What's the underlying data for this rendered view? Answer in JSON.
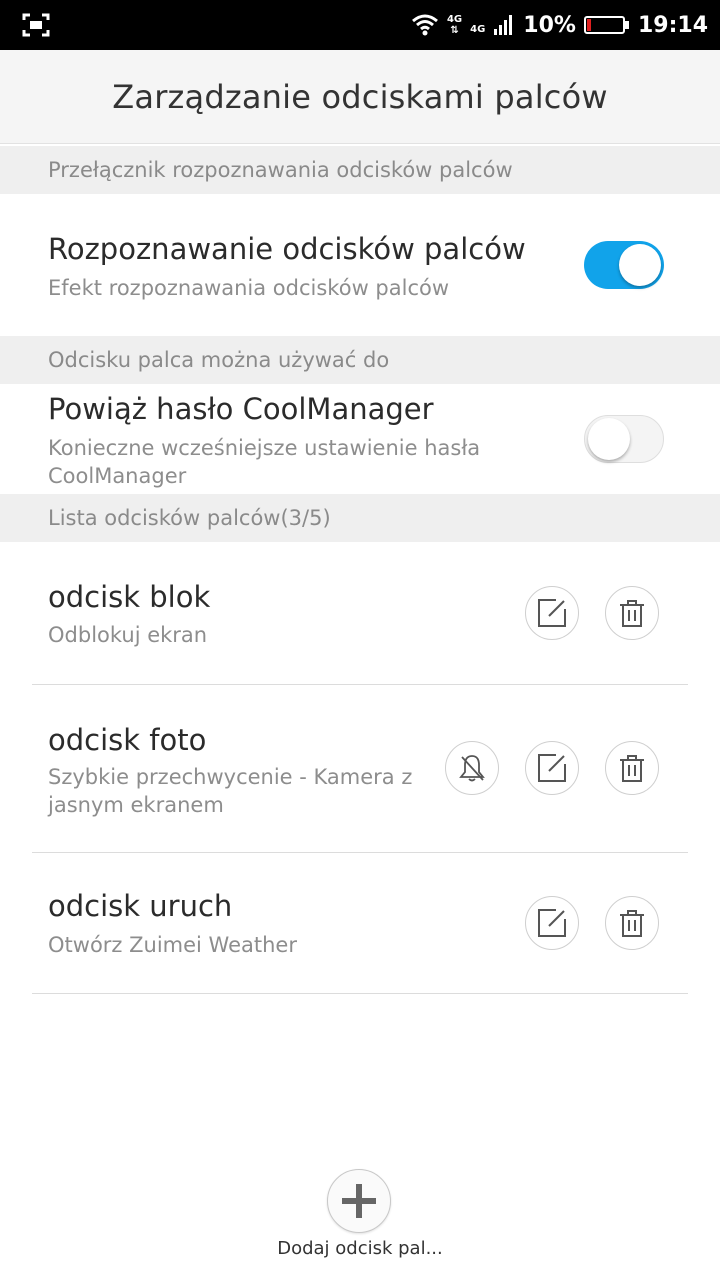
{
  "status_bar": {
    "network_top": "4G",
    "network_bottom": "4G",
    "battery": "10%",
    "time": "19:14",
    "icons": [
      "screenshot-icon",
      "wifi-icon",
      "signal-icon",
      "battery-icon"
    ]
  },
  "title": "Zarządzanie odciskami palców",
  "sections": {
    "switch_header": "Przełącznik rozpoznawania odcisków palców",
    "use_header": "Odcisku palca można używać do",
    "list_header": "Lista odcisków palców(3/5)"
  },
  "recognition": {
    "title": "Rozpoznawanie odcisków palców",
    "subtitle": "Efekt rozpoznawania odcisków palców",
    "enabled": true
  },
  "coolmanager": {
    "title": "Powiąż hasło CoolManager",
    "subtitle_line1": "Konieczne wcześniejsze ustawienie hasła",
    "subtitle_line2": "CoolManager",
    "enabled": false
  },
  "fingerprints": [
    {
      "name": "odcisk blok",
      "action_line1": "Odblokuj ekran",
      "action_line2": "",
      "has_bell": false
    },
    {
      "name": "odcisk foto",
      "action_line1": "Szybkie przechwycenie - Kamera z",
      "action_line2": "jasnym ekranem",
      "has_bell": true
    },
    {
      "name": "odcisk uruch",
      "action_line1": "Otwórz Zuimei Weather",
      "action_line2": "",
      "has_bell": false
    }
  ],
  "add_button": {
    "label": "Dodaj odcisk pal..."
  },
  "colors": {
    "accent": "#11a3ea",
    "header_bg": "#efefef",
    "titlebar_bg": "#f5f5f5",
    "battery_low": "#e02020"
  }
}
